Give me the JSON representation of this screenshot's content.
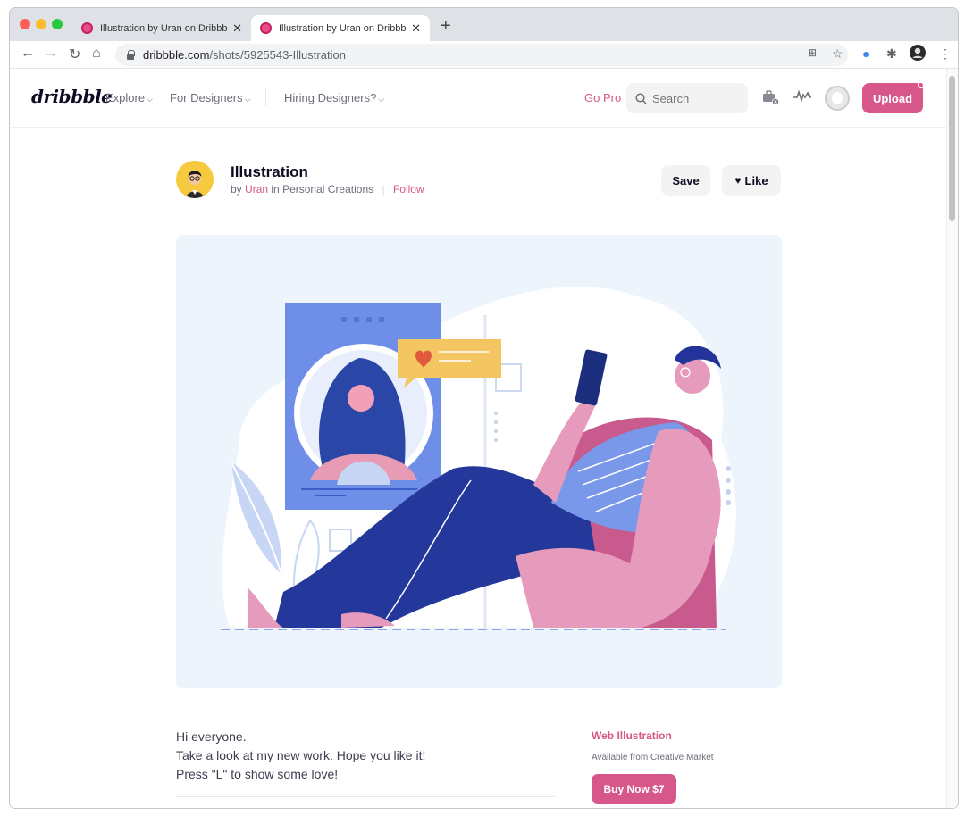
{
  "browser": {
    "tabs": [
      {
        "title": "Illustration by Uran on Dribbble",
        "close": "✕"
      },
      {
        "title": "Illustration by Uran on Dribbble",
        "close": "✕"
      }
    ],
    "new_tab": "+",
    "url_host": "dribbble.com",
    "url_path": "/shots/5925543-Illustration"
  },
  "header": {
    "logo": "dribbble",
    "nav": [
      {
        "label": "Explore"
      },
      {
        "label": "For Designers"
      },
      {
        "label": "Hiring Designers?"
      }
    ],
    "gopro": "Go Pro",
    "search_placeholder": "Search",
    "upload": "Upload"
  },
  "shot": {
    "title": "Illustration",
    "by": "by",
    "author": "Uran",
    "in": "in",
    "team": "Personal Creations",
    "follow": "Follow",
    "save": "Save",
    "like": "Like"
  },
  "description": {
    "lines": [
      "Hi everyone.",
      "Take a look at my new work. Hope you like it!",
      "Press \"L\" to show some love!"
    ]
  },
  "product": {
    "title": "Web Illustration",
    "subtitle": "Available from Creative Market",
    "buy": "Buy Now $7"
  },
  "colors": {
    "brand_pink": "#d8578b",
    "illustration_bg": "#edf4fc",
    "dark_navy": "#1f3a8f"
  },
  "icons": [
    "back-icon",
    "forward-icon",
    "reload-icon",
    "home-icon",
    "lock-icon",
    "translate-icon",
    "star-icon",
    "extension-icon",
    "puzzle-icon",
    "profile-icon",
    "menu-icon",
    "search-icon",
    "briefcase-icon",
    "activity-icon",
    "heart-icon"
  ]
}
